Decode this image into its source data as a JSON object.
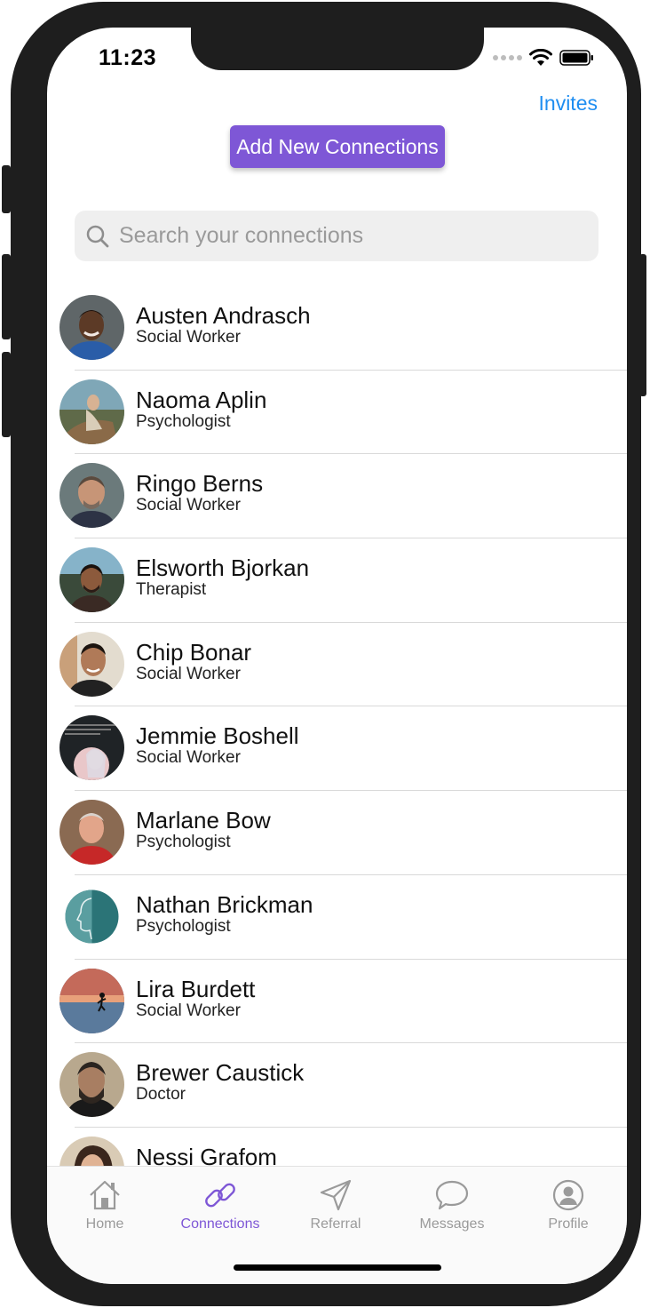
{
  "status_bar": {
    "time": "11:23",
    "icons": [
      "signal-dots-icon",
      "wifi-icon",
      "battery-icon"
    ]
  },
  "header": {
    "invites_label": "Invites",
    "add_button_label": "Add New Connections",
    "accent_color": "#7e57d6",
    "link_color": "#1f8ef1"
  },
  "search": {
    "placeholder": "Search your connections",
    "icon": "search-icon"
  },
  "connections": [
    {
      "name": "Austen Andrasch",
      "role": "Social Worker"
    },
    {
      "name": "Naoma Aplin",
      "role": "Psychologist"
    },
    {
      "name": "Ringo Berns",
      "role": "Social Worker"
    },
    {
      "name": "Elsworth Bjorkan",
      "role": "Therapist"
    },
    {
      "name": "Chip Bonar",
      "role": "Social Worker"
    },
    {
      "name": "Jemmie Boshell",
      "role": "Social Worker"
    },
    {
      "name": "Marlane Bow",
      "role": "Psychologist"
    },
    {
      "name": "Nathan Brickman",
      "role": "Psychologist"
    },
    {
      "name": "Lira Burdett",
      "role": "Social Worker"
    },
    {
      "name": "Brewer Caustick",
      "role": "Doctor"
    },
    {
      "name": "Nessi Grafom",
      "role": ""
    }
  ],
  "tab_bar": {
    "active_index": 1,
    "tabs": [
      {
        "label": "Home",
        "icon": "home-icon"
      },
      {
        "label": "Connections",
        "icon": "link-icon"
      },
      {
        "label": "Referral",
        "icon": "send-icon"
      },
      {
        "label": "Messages",
        "icon": "chat-bubble-icon"
      },
      {
        "label": "Profile",
        "icon": "user-circle-icon"
      }
    ]
  }
}
